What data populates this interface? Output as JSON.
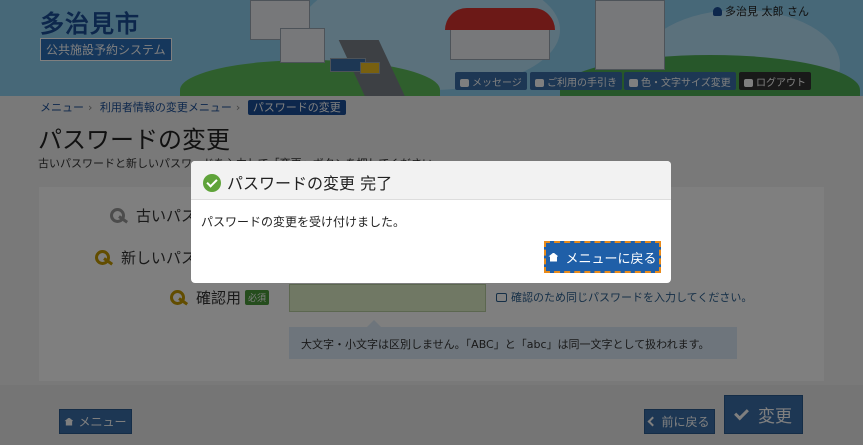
{
  "header": {
    "city_name": "多治見市",
    "system_name": "公共施設予約システム",
    "user_name": "多治見 太郎 さん",
    "nav": [
      {
        "label": "メッセージ",
        "icon": "speech-bubble-icon"
      },
      {
        "label": "ご利用の手引き",
        "icon": "book-icon"
      },
      {
        "label": "色・文字サイズ変更",
        "icon": "paint-brush-icon"
      },
      {
        "label": "ログアウト",
        "icon": "sign-out-icon"
      }
    ]
  },
  "breadcrumb": {
    "items": [
      "メニュー",
      "利用者情報の変更メニュー"
    ],
    "current": "パスワードの変更"
  },
  "page": {
    "title": "パスワードの変更",
    "description": "古いパスワードと新しいパスワードを入力して「変更」ボタンを押してください。"
  },
  "form": {
    "old_password_label": "古いパスワード",
    "new_password_label": "新しいパスワード",
    "confirm_label": "確認用",
    "required_badge": "必須",
    "confirm_hint": "確認のため同じパスワードを入力してください。",
    "note": "大文字・小文字は区別しません。「ABC」と「abc」は同一文字として扱われます。"
  },
  "footer": {
    "menu_label": "メニュー",
    "back_label": "前に戻る",
    "submit_label": "変更"
  },
  "modal": {
    "title": "パスワードの変更 完了",
    "message": "パスワードの変更を受け付けました。",
    "button_label": "メニューに戻る"
  },
  "colors": {
    "primary": "#1f5fa8",
    "success": "#5fa33a",
    "focus_outline": "#e88a1a"
  }
}
